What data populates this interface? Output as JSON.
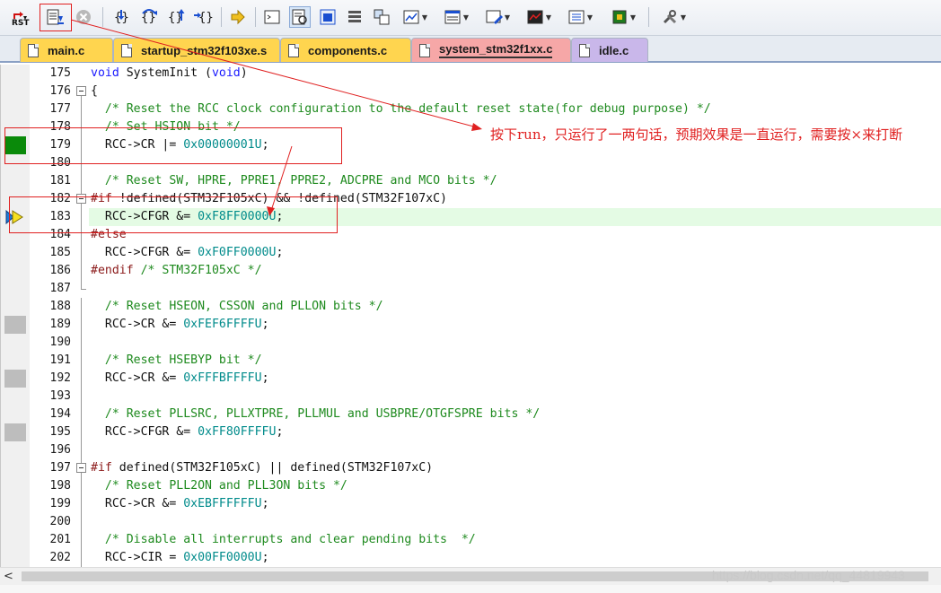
{
  "toolbar": {
    "rst_label": "RST",
    "buttons": [
      "reset-button",
      "run-button",
      "stop-button",
      "step-into-button",
      "step-over-button",
      "step-out-button",
      "run-to-cursor-button",
      "show-next-statement-button",
      "command-window-button",
      "disassembly-window-button",
      "symbols-window-button",
      "registers-window-button",
      "call-stack-window-button",
      "watch-window-button",
      "memory-window-button",
      "serial-window-button",
      "analysis-window-button",
      "trace-window-button",
      "system-viewer-button",
      "toolbox-button"
    ]
  },
  "tabs": [
    {
      "label": "main.c",
      "color": "#ffd54f",
      "active": false
    },
    {
      "label": "startup_stm32f103xe.s",
      "color": "#ffd54f",
      "active": false
    },
    {
      "label": "components.c",
      "color": "#ffd54f",
      "active": false
    },
    {
      "label": "system_stm32f1xx.c",
      "color": "#f6a7a7",
      "active": true
    },
    {
      "label": "idle.c",
      "color": "#c9b7ea",
      "active": false
    }
  ],
  "editor": {
    "lines": [
      {
        "num": "175",
        "text": "void SystemInit (void)"
      },
      {
        "num": "176",
        "text": "{"
      },
      {
        "num": "177",
        "text": "  /* Reset the RCC clock configuration to the default reset state(for debug purpose) */"
      },
      {
        "num": "178",
        "text": "  /* Set HSION bit */"
      },
      {
        "num": "179",
        "text": "  RCC->CR |= 0x00000001U;"
      },
      {
        "num": "180",
        "text": ""
      },
      {
        "num": "181",
        "text": "  /* Reset SW, HPRE, PPRE1, PPRE2, ADCPRE and MCO bits */"
      },
      {
        "num": "182",
        "text": "#if !defined(STM32F105xC) && !defined(STM32F107xC)"
      },
      {
        "num": "183",
        "text": "  RCC->CFGR &= 0xF8FF0000U;"
      },
      {
        "num": "184",
        "text": "#else"
      },
      {
        "num": "185",
        "text": "  RCC->CFGR &= 0xF0FF0000U;"
      },
      {
        "num": "186",
        "text": "#endif /* STM32F105xC */"
      },
      {
        "num": "187",
        "text": ""
      },
      {
        "num": "188",
        "text": "  /* Reset HSEON, CSSON and PLLON bits */"
      },
      {
        "num": "189",
        "text": "  RCC->CR &= 0xFEF6FFFFU;"
      },
      {
        "num": "190",
        "text": ""
      },
      {
        "num": "191",
        "text": "  /* Reset HSEBYP bit */"
      },
      {
        "num": "192",
        "text": "  RCC->CR &= 0xFFFBFFFFU;"
      },
      {
        "num": "193",
        "text": ""
      },
      {
        "num": "194",
        "text": "  /* Reset PLLSRC, PLLXTPRE, PLLMUL and USBPRE/OTGFSPRE bits */"
      },
      {
        "num": "195",
        "text": "  RCC->CFGR &= 0xFF80FFFFU;"
      },
      {
        "num": "196",
        "text": ""
      },
      {
        "num": "197",
        "text": "#if defined(STM32F105xC) || defined(STM32F107xC)"
      },
      {
        "num": "198",
        "text": "  /* Reset PLL2ON and PLL3ON bits */"
      },
      {
        "num": "199",
        "text": "  RCC->CR &= 0xEBFFFFFFU;"
      },
      {
        "num": "200",
        "text": ""
      },
      {
        "num": "201",
        "text": "  /* Disable all interrupts and clear pending bits  */"
      },
      {
        "num": "202",
        "text": "  RCC->CIR = 0x00FF0000U;"
      }
    ],
    "current_line": "183",
    "executed_marker_line": "179",
    "coverage_marker_lines": [
      "189",
      "192",
      "195"
    ]
  },
  "annotation": {
    "text": "按下run，只运行了一两句话，预期效果是一直运行，需要按×来打断",
    "color": "#e02020"
  },
  "watermark": "https://blog.csdn.net/qq_44819943",
  "scrollbar": {
    "left_arrow": "<"
  }
}
